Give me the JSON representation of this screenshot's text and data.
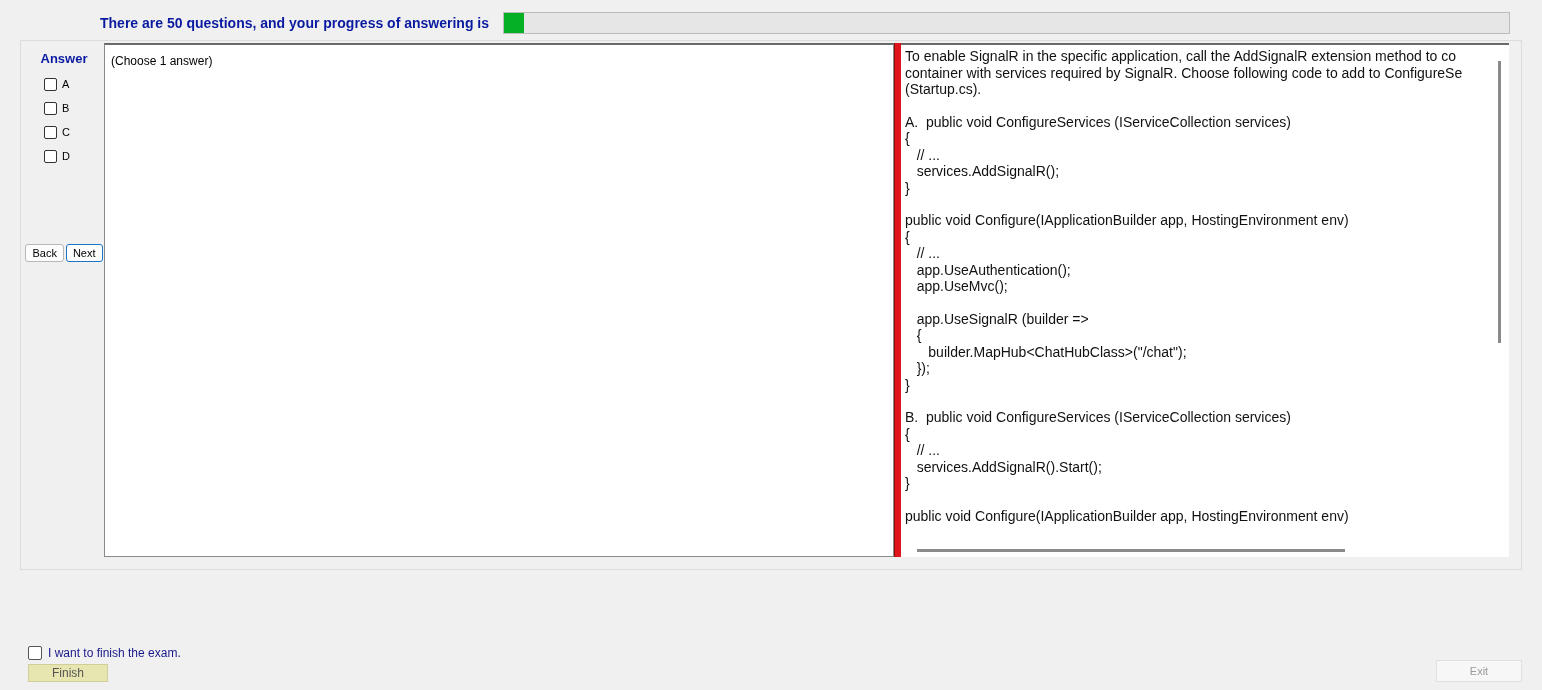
{
  "header": {
    "text": "There are 50 questions, and your progress of answering is",
    "progress": {
      "level": 0.02
    }
  },
  "answer_panel": {
    "title": "Answer",
    "options": [
      {
        "label": "A",
        "checked": false
      },
      {
        "label": "B",
        "checked": false
      },
      {
        "label": "C",
        "checked": false
      },
      {
        "label": "D",
        "checked": false
      }
    ],
    "buttons": [
      {
        "label": "Back",
        "focused": false
      },
      {
        "label": "Next",
        "focused": true
      }
    ]
  },
  "answer_hint": "(Choose 1 answer)",
  "question": {
    "paragraphs": [
      [
        "To enable SignalR in the specific application, call the AddSignalR extension method to co",
        "container with services required by SignalR. Choose following code to add to ConfigureSe",
        "(Startup.cs)."
      ],
      [
        "A.  public void ConfigureServices (IServiceCollection services)",
        "{",
        "   // ...",
        "   services.AddSignalR();",
        "}"
      ],
      [
        "public void Configure(IApplicationBuilder app, HostingEnvironment env)",
        "{",
        "   // ...",
        "   app.UseAuthentication();",
        "   app.UseMvc();"
      ],
      [
        "   app.UseSignalR (builder =>",
        "   {",
        "      builder.MapHub<ChatHubClass>(\"/chat\");",
        "   });",
        "}"
      ],
      [
        "B.  public void ConfigureServices (IServiceCollection services)",
        "{",
        "   // ...",
        "   services.AddSignalR().Start();",
        "}"
      ],
      [
        "public void Configure(IApplicationBuilder app, HostingEnvironment env)"
      ]
    ]
  },
  "finish": {
    "label": "I want to finish the exam.",
    "checked": false,
    "button": "Finish"
  },
  "exit": {
    "label": "Exit",
    "disabled": true
  }
}
